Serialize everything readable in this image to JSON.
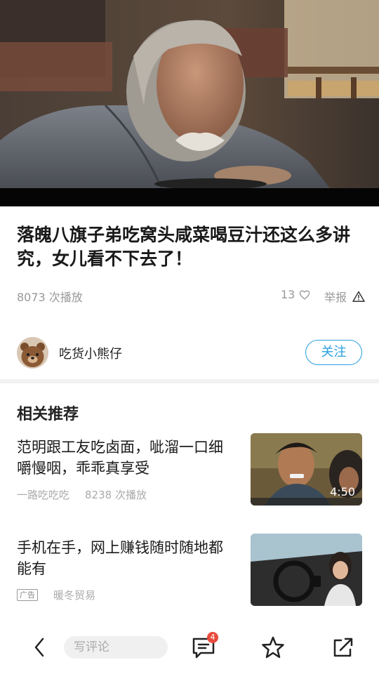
{
  "video": {
    "thumbnail_description": "elderly man with bowl"
  },
  "title": "落魄八旗子弟吃窝头咸菜喝豆汁还这么多讲究，女儿看不下去了！",
  "meta": {
    "plays": "8073 次播放",
    "likes": "13",
    "report_label": "举报"
  },
  "author": {
    "name": "吃货小熊仔",
    "follow_label": "关注"
  },
  "section_title": "相关推荐",
  "related": [
    {
      "title": "范明跟工友吃卤面，呲溜一口细嚼慢咽，乖乖真享受",
      "source": "一路吃吃吃",
      "plays": "8238 次播放",
      "duration": "4:50"
    },
    {
      "title": "手机在手，网上赚钱随时随地都能有",
      "ad_tag": "广告",
      "source": "暖冬贸易"
    }
  ],
  "bottom_bar": {
    "comment_placeholder": "写评论",
    "comment_count": "4"
  },
  "colors": {
    "accent": "#2b9fe0",
    "badge": "#e94b3c"
  }
}
